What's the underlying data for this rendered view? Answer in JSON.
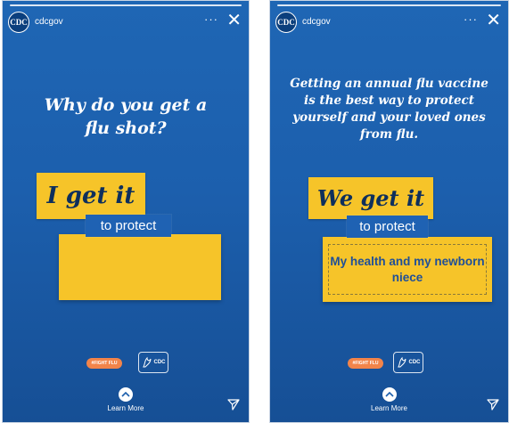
{
  "story_left": {
    "avatar_label": "CDC",
    "account": "cdcgov",
    "more_label": "···",
    "close_label": "✕",
    "question": "Why do you get a flu shot?",
    "tag": "I get it",
    "protect": "to protect",
    "fight_badge": "#FIGHT FLU",
    "hhs_label": "CDC",
    "learn_more": "Learn More"
  },
  "story_right": {
    "avatar_label": "CDC",
    "account": "cdcgov",
    "more_label": "···",
    "close_label": "✕",
    "statement": "Getting an annual flu vaccine is the best way to protect yourself and your loved ones from flu.",
    "tag": "We get it",
    "protect": "to protect",
    "answer": "My health and my newborn niece",
    "fight_badge": "#FIGHT FLU",
    "hhs_label": "CDC",
    "learn_more": "Learn More"
  },
  "colors": {
    "story_blue": "#1c5fad",
    "yellow": "#f6c429",
    "chip_blue": "#1f62b3",
    "answer_text": "#1f4f98",
    "fight_orange": "#f2844a"
  },
  "icons": {
    "close": "close-icon",
    "more": "more-options-icon",
    "learn_more": "chevron-up-icon",
    "send": "send-icon",
    "hhs": "hhs-eagle-icon"
  }
}
